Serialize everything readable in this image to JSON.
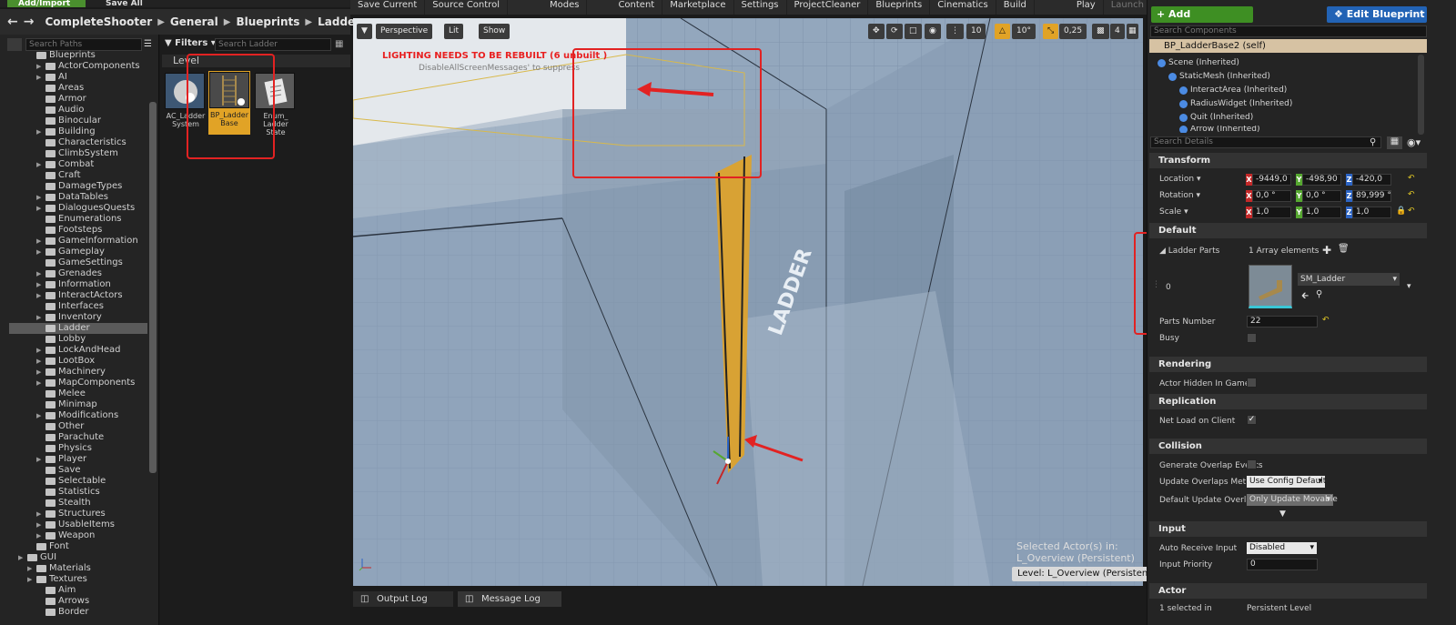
{
  "top": {
    "add_import": "Add/Import",
    "save_all": "Save All"
  },
  "path": [
    "CompleteShooter",
    "General",
    "Blueprints",
    "Ladder"
  ],
  "search_paths_placeholder": "Search Paths",
  "tree_items": [
    {
      "label": "Blueprints",
      "depth": 2
    },
    {
      "label": "ActorComponents",
      "depth": 3,
      "arrow": true
    },
    {
      "label": "AI",
      "depth": 3,
      "arrow": true
    },
    {
      "label": "Areas",
      "depth": 3
    },
    {
      "label": "Armor",
      "depth": 3
    },
    {
      "label": "Audio",
      "depth": 3
    },
    {
      "label": "Binocular",
      "depth": 3
    },
    {
      "label": "Building",
      "depth": 3,
      "arrow": true
    },
    {
      "label": "Characteristics",
      "depth": 3
    },
    {
      "label": "ClimbSystem",
      "depth": 3
    },
    {
      "label": "Combat",
      "depth": 3,
      "arrow": true
    },
    {
      "label": "Craft",
      "depth": 3
    },
    {
      "label": "DamageTypes",
      "depth": 3
    },
    {
      "label": "DataTables",
      "depth": 3,
      "arrow": true
    },
    {
      "label": "DialoguesQuests",
      "depth": 3,
      "arrow": true
    },
    {
      "label": "Enumerations",
      "depth": 3
    },
    {
      "label": "Footsteps",
      "depth": 3
    },
    {
      "label": "GameInformation",
      "depth": 3,
      "arrow": true
    },
    {
      "label": "Gameplay",
      "depth": 3,
      "arrow": true
    },
    {
      "label": "GameSettings",
      "depth": 3
    },
    {
      "label": "Grenades",
      "depth": 3,
      "arrow": true
    },
    {
      "label": "Information",
      "depth": 3,
      "arrow": true
    },
    {
      "label": "InteractActors",
      "depth": 3,
      "arrow": true
    },
    {
      "label": "Interfaces",
      "depth": 3
    },
    {
      "label": "Inventory",
      "depth": 3,
      "arrow": true
    },
    {
      "label": "Ladder",
      "depth": 3,
      "selected": true
    },
    {
      "label": "Lobby",
      "depth": 3
    },
    {
      "label": "LockAndHead",
      "depth": 3,
      "arrow": true
    },
    {
      "label": "LootBox",
      "depth": 3,
      "arrow": true
    },
    {
      "label": "Machinery",
      "depth": 3,
      "arrow": true
    },
    {
      "label": "MapComponents",
      "depth": 3,
      "arrow": true
    },
    {
      "label": "Melee",
      "depth": 3
    },
    {
      "label": "Minimap",
      "depth": 3
    },
    {
      "label": "Modifications",
      "depth": 3,
      "arrow": true
    },
    {
      "label": "Other",
      "depth": 3
    },
    {
      "label": "Parachute",
      "depth": 3
    },
    {
      "label": "Physics",
      "depth": 3
    },
    {
      "label": "Player",
      "depth": 3,
      "arrow": true
    },
    {
      "label": "Save",
      "depth": 3
    },
    {
      "label": "Selectable",
      "depth": 3
    },
    {
      "label": "Statistics",
      "depth": 3
    },
    {
      "label": "Stealth",
      "depth": 3
    },
    {
      "label": "Structures",
      "depth": 3,
      "arrow": true
    },
    {
      "label": "UsableItems",
      "depth": 3,
      "arrow": true
    },
    {
      "label": "Weapon",
      "depth": 3,
      "arrow": true
    },
    {
      "label": "Font",
      "depth": 2
    },
    {
      "label": "GUI",
      "depth": 1,
      "arrow": true
    },
    {
      "label": "Materials",
      "depth": 2,
      "arrow": true
    },
    {
      "label": "Textures",
      "depth": 2,
      "arrow": true
    },
    {
      "label": "Aim",
      "depth": 3
    },
    {
      "label": "Arrows",
      "depth": 3
    },
    {
      "label": "Border",
      "depth": 3
    }
  ],
  "assets": {
    "filters_label": "Filters",
    "search_placeholder": "Search Ladder",
    "group_header": "Level",
    "tiles": [
      {
        "label": "AC_Ladder System",
        "selected": false
      },
      {
        "label": "BP_Ladder Base",
        "selected": true
      },
      {
        "label": "Enum_ Ladder State",
        "selected": false
      }
    ]
  },
  "toolbar": [
    "Save Current",
    "Source Control",
    "Modes",
    "Content",
    "Marketplace",
    "Settings",
    "ProjectCleaner",
    "Blueprints",
    "Cinematics",
    "Build",
    "Play",
    "Launch"
  ],
  "viewport": {
    "perspective": "Perspective",
    "lit": "Lit",
    "show": "Show",
    "grid_snap": "10",
    "rot_snap": "10°",
    "scale_snap": "0,25",
    "cam_speed": "4",
    "lighting_warning": "LIGHTING NEEDS TO BE REBUILT (6 unbuilt )",
    "lighting_sub": "DisableAllScreenMessages' to suppress",
    "wall_text": "LADDER",
    "selected_actor_line1": "Selected Actor(s) in:",
    "selected_actor_line2": "L_Overview (Persistent)",
    "level_badge": "Level:  L_Overview (Persistent)"
  },
  "bottom_tabs": [
    "Output Log",
    "Message Log"
  ],
  "details": {
    "add_component": "+ Add Component",
    "edit_blueprint": "Edit Blueprint",
    "search_components_placeholder": "Search Components",
    "self_row": "BP_LadderBase2 (self)",
    "components": [
      {
        "label": "Scene (Inherited)",
        "depth": 0
      },
      {
        "label": "StaticMesh (Inherited)",
        "depth": 1
      },
      {
        "label": "InteractArea (Inherited)",
        "depth": 2
      },
      {
        "label": "RadiusWidget (Inherited)",
        "depth": 2
      },
      {
        "label": "Quit (Inherited)",
        "depth": 2
      },
      {
        "label": "Arrow (Inherited)",
        "depth": 2
      }
    ],
    "search_details_placeholder": "Search Details",
    "transform": {
      "header": "Transform",
      "location_label": "Location",
      "rotation_label": "Rotation",
      "scale_label": "Scale",
      "location": [
        "-9449,0",
        "-498,90",
        "-420,0"
      ],
      "rotation": [
        "0,0 °",
        "0,0 °",
        "89,999 °"
      ],
      "scale": [
        "1,0",
        "1,0",
        "1,0"
      ]
    },
    "default": {
      "header": "Default",
      "ladder_parts_label": "Ladder Parts",
      "array_count": "1 Array elements",
      "index_label": "0",
      "mesh_name": "SM_Ladder",
      "parts_number_label": "Parts Number",
      "parts_number": "22",
      "busy_label": "Busy"
    },
    "rendering": {
      "header": "Rendering",
      "hidden_label": "Actor Hidden In Game"
    },
    "replication": {
      "header": "Replication",
      "net_load_label": "Net Load on Client"
    },
    "collision": {
      "header": "Collision",
      "gen_overlap_label": "Generate Overlap Events",
      "update_overlaps_label": "Update Overlaps Method",
      "update_overlaps_value": "Use Config Default",
      "default_update_label": "Default Update Overlaps",
      "default_update_value": "Only Update Movable"
    },
    "input": {
      "header": "Input",
      "auto_receive_label": "Auto Receive Input",
      "auto_receive_value": "Disabled",
      "input_priority_label": "Input Priority",
      "input_priority_value": "0"
    },
    "actor": {
      "header": "Actor",
      "selected_in_label": "1 selected in",
      "selected_in_value": "Persistent Level"
    }
  },
  "colors": {
    "selection": "#e1a326",
    "highlight_box": "#e22222",
    "add_component": "#3e8f23",
    "edit_blueprint": "#2263b5"
  }
}
